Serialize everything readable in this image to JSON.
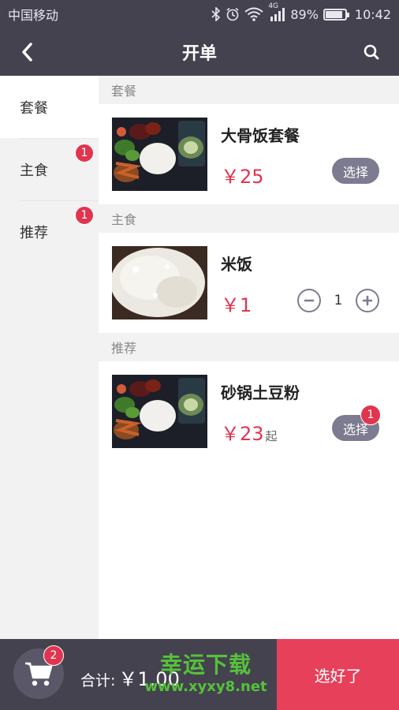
{
  "status_bar": {
    "carrier": "中国移动",
    "network": "4G",
    "battery": "89%",
    "battery_level": 0.89,
    "time": "10:42"
  },
  "nav": {
    "title": "开单",
    "back_icon": "chevron-left-icon",
    "search_icon": "search-icon"
  },
  "sidebar": {
    "items": [
      {
        "label": "套餐",
        "badge": "",
        "active": true
      },
      {
        "label": "主食",
        "badge": "1",
        "active": false
      },
      {
        "label": "推荐",
        "badge": "1",
        "active": false
      }
    ]
  },
  "sections": [
    {
      "header": "套餐",
      "product": {
        "name": "大骨饭套餐",
        "price": "￥25",
        "suffix": "",
        "action": "选择",
        "badge": ""
      }
    },
    {
      "header": "主食",
      "product": {
        "name": "米饭",
        "price": "￥1",
        "suffix": "",
        "quantity": "1"
      }
    },
    {
      "header": "推荐",
      "product": {
        "name": "砂锅土豆粉",
        "price": "￥23",
        "suffix": "起",
        "action": "选择",
        "badge": "1"
      }
    }
  ],
  "bottom_bar": {
    "cart_icon": "cart-icon",
    "cart_badge": "2",
    "total_label": "合计:",
    "total_amount": "￥1.00",
    "confirm_label": "选好了"
  },
  "watermark": {
    "title": "幸运下载",
    "url": "www.xyxy8.net"
  },
  "colors": {
    "bar": "#44424f",
    "accent": "#e0354f",
    "button": "#7d7b8f"
  }
}
